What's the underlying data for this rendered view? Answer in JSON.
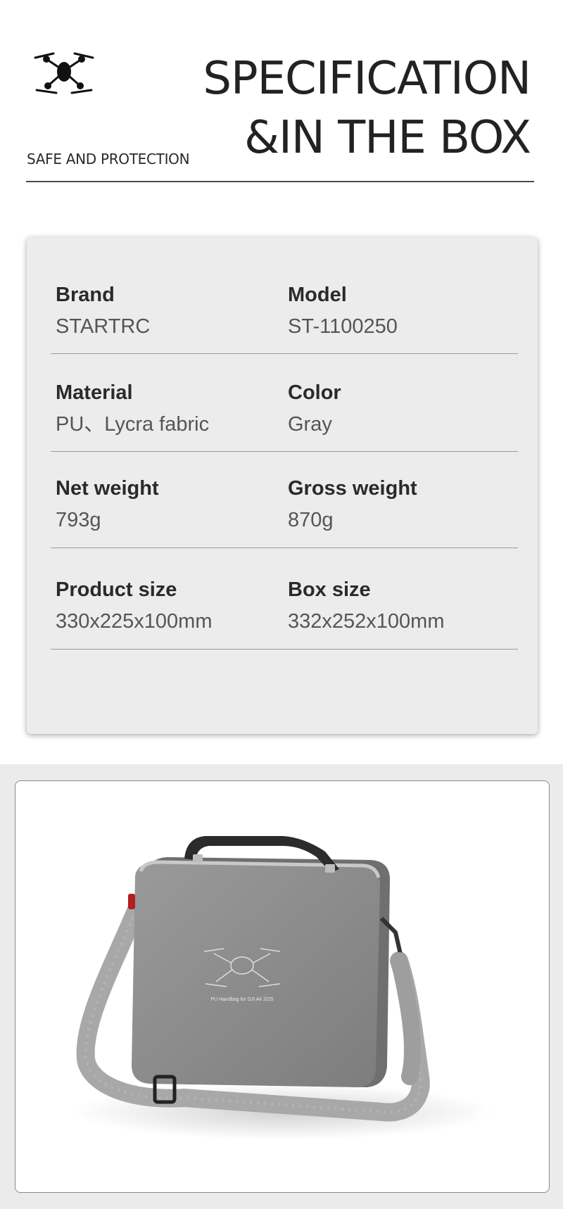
{
  "header": {
    "logo_icon": "drone-icon",
    "title_line1": "SPECIFICATION",
    "title_line2": "&IN THE BOX",
    "subtitle": "SAFE AND PROTECTION"
  },
  "specs": [
    {
      "left_label": "Brand",
      "left_value": "STARTRC",
      "right_label": "Model",
      "right_value": "ST-1100250"
    },
    {
      "left_label": "Material",
      "left_value": "PU、Lycra fabric",
      "right_label": "Color",
      "right_value": "Gray"
    },
    {
      "left_label": "Net weight",
      "left_value": "793g",
      "right_label": "Gross weight",
      "right_value": "870g"
    },
    {
      "left_label": "Product size",
      "left_value": "330x225x100mm",
      "right_label": "Box size",
      "right_value": "332x252x100mm"
    }
  ],
  "product": {
    "bag_print": "PU Handbag for DJI Air 2/2S",
    "colors": {
      "bag": "#8e8e8e",
      "strap": "#a9a9a9",
      "handle": "#2b2b2b"
    }
  }
}
